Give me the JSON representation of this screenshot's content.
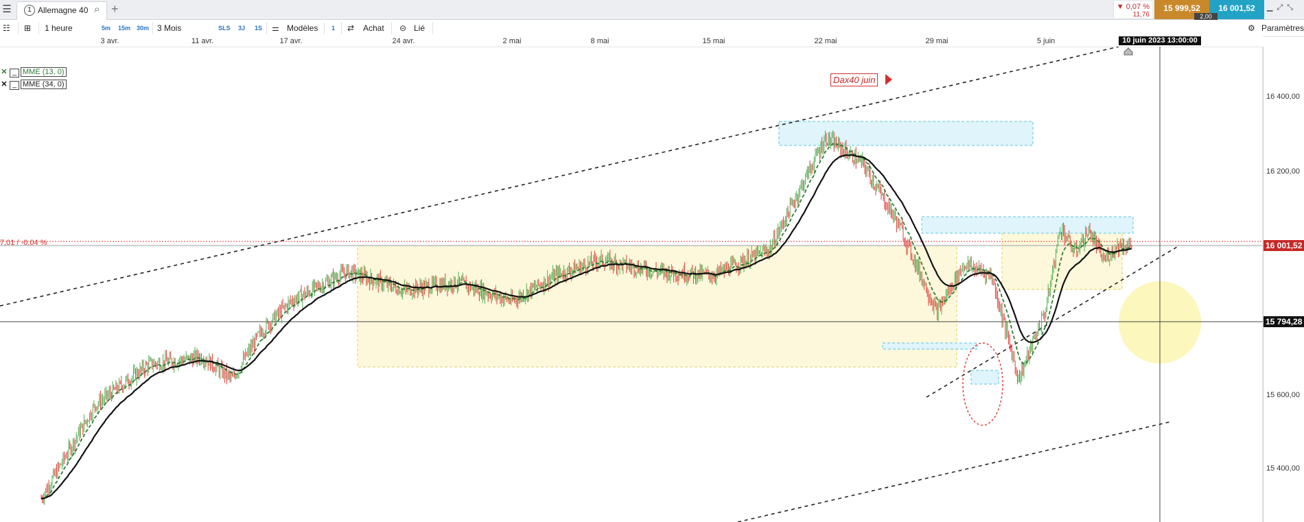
{
  "tab": {
    "number": "1",
    "title": "Allemagne 40"
  },
  "quote": {
    "change_pct": "▼ 0,07 %",
    "change_pts": "11,76",
    "bid": "15 999,52",
    "ask": "16 001,52",
    "spread": "2,00"
  },
  "toolbar": {
    "interval": "1 heure",
    "quick_intervals": [
      "5m",
      "15m",
      "30m"
    ],
    "period": "3 Mois",
    "quick_periods": [
      "SLS",
      "3J",
      "1S"
    ],
    "models_label": "Modèles",
    "one_label": "1",
    "buy_label": "Achat",
    "linked_label": "Lié",
    "settings_label": "Paramètres"
  },
  "date_axis": {
    "labels": [
      "3 avr.",
      "11 avr.",
      "17 avr.",
      "24 avr.",
      "2 mai",
      "8 mai",
      "15 mai",
      "22 mai",
      "29 mai",
      "5 juin"
    ],
    "cursor_date": "10 juin 2023 13:00:00"
  },
  "price_axis": {
    "labels": [
      "16 400,00",
      "16 200,00",
      "15 600,00",
      "15 400,00"
    ],
    "current_price": "16 001,52",
    "cursor_price": "15 794,28"
  },
  "legend": [
    {
      "label": "MME (13, 0)",
      "color": "#2e7d32"
    },
    {
      "label": "MME (34, 0)",
      "color": "#111111"
    }
  ],
  "price_line_label": "7,01 / -0,04 %",
  "annotation": "Dax40 juin",
  "colors": {
    "up": "#4caf50",
    "down": "#e53935",
    "zone_yellow": "#fdf8dc",
    "zone_blue": "#dff4fb",
    "bid": "#c9892b",
    "ask": "#22a3c6"
  },
  "chart_data": {
    "type": "candlestick",
    "instrument": "Allemagne 40",
    "timeframe": "1 heure",
    "x_labels": [
      "3 avr.",
      "11 avr.",
      "17 avr.",
      "24 avr.",
      "2 mai",
      "8 mai",
      "15 mai",
      "22 mai",
      "29 mai",
      "5 juin"
    ],
    "ylim": [
      15320,
      16560
    ],
    "y_ticks": [
      15400,
      15600,
      16200,
      16400
    ],
    "path": [
      {
        "x": "3 avr.",
        "y": 15320
      },
      {
        "x": "3 avr.",
        "y": 15570
      },
      {
        "x": "3 avr.",
        "y": 15680
      },
      {
        "x": "11 avr.",
        "y": 15700
      },
      {
        "x": "11 avr.",
        "y": 15640
      },
      {
        "x": "11 avr.",
        "y": 15770
      },
      {
        "x": "17 avr.",
        "y": 15850
      },
      {
        "x": "17 avr.",
        "y": 15930
      },
      {
        "x": "24 avr.",
        "y": 15880
      },
      {
        "x": "24 avr.",
        "y": 15900
      },
      {
        "x": "2 mai",
        "y": 15850
      },
      {
        "x": "2 mai",
        "y": 15920
      },
      {
        "x": "8 mai",
        "y": 15960
      },
      {
        "x": "8 mai",
        "y": 15930
      },
      {
        "x": "15 mai",
        "y": 15920
      },
      {
        "x": "15 mai",
        "y": 15990
      },
      {
        "x": "22 mai",
        "y": 16290
      },
      {
        "x": "22 mai",
        "y": 16220
      },
      {
        "x": "22 mai",
        "y": 16050
      },
      {
        "x": "29 mai",
        "y": 15820
      },
      {
        "x": "29 mai",
        "y": 15950
      },
      {
        "x": "29 mai",
        "y": 15920
      },
      {
        "x": "29 mai",
        "y": 15640
      },
      {
        "x": "5 juin",
        "y": 15830
      },
      {
        "x": "5 juin",
        "y": 16050
      },
      {
        "x": "5 juin",
        "y": 15980
      },
      {
        "x": "5 juin",
        "y": 16040
      },
      {
        "x": "5 juin",
        "y": 15960
      },
      {
        "x": "5 juin",
        "y": 16000
      }
    ],
    "indicators": [
      "MME (13, 0)",
      "MME (34, 0)"
    ],
    "current_price": 16001.52,
    "cursor_price": 15794.28
  }
}
